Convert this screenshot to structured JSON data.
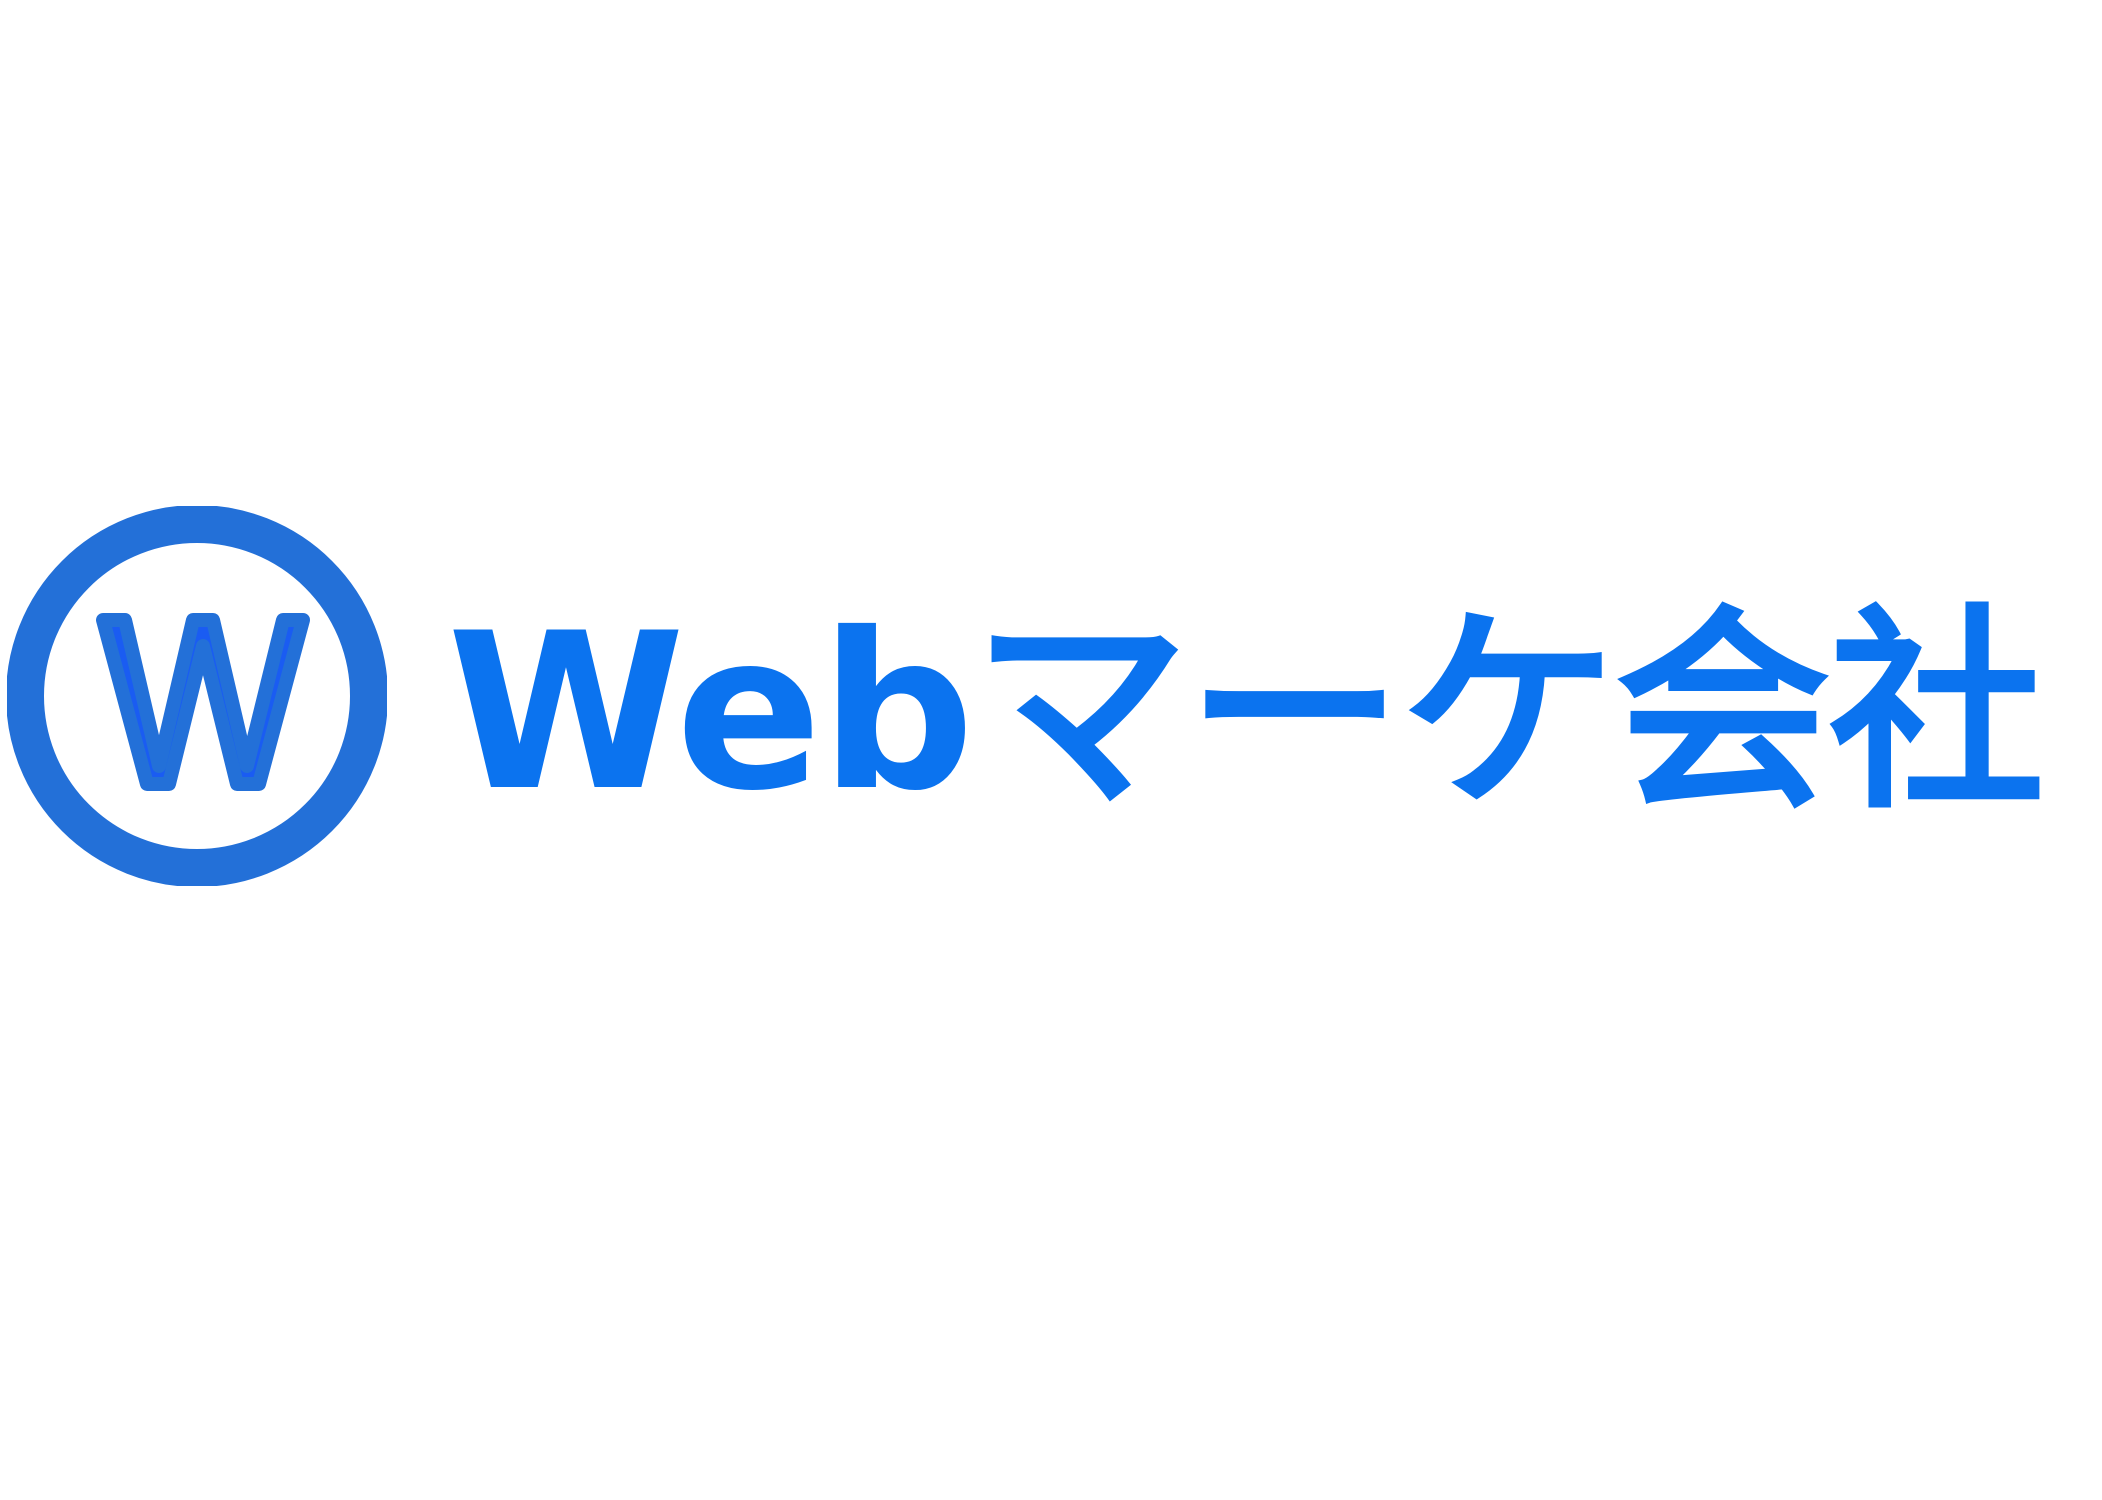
{
  "logo": {
    "emblem_letter": "W",
    "wordmark": "Webマーケ会社",
    "colors": {
      "ring": "#2370d8",
      "letter_fill": "#1a5cf2",
      "letter_outline": "#2370d8",
      "wordmark": "#0b73ef",
      "background": "#ffffff"
    }
  }
}
